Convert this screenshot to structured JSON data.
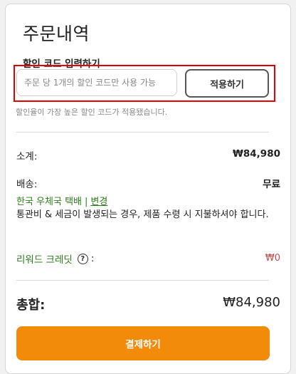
{
  "order": {
    "title": "주문내역",
    "promo": {
      "label": "할인 코드 입력하기",
      "placeholder": "주문 당 1개의 할인 코드만 사용 가능",
      "apply_label": "적용하기",
      "note": "할인율이 가장 높은 할인 코드가 적용됐습니다."
    },
    "subtotal": {
      "label": "소계:",
      "value": "₩84,980"
    },
    "shipping": {
      "label": "배송:",
      "value": "무료",
      "method": "한국 우체국 택배",
      "separator": "|",
      "change_label": "변경",
      "note": "통관비 & 세금이 발생되는 경우, 제품 수령 시 지불하셔야 합니다."
    },
    "reward": {
      "label": "리워드 크레딧",
      "help_icon": "?",
      "colon": ":",
      "value": "₩0"
    },
    "total": {
      "label": "총합:",
      "value": "₩84,980"
    },
    "checkout_label": "결제하기"
  },
  "colors": {
    "accent": "#f28a0a",
    "highlight_border": "#e30000",
    "green_text": "#2e7d1e",
    "reward_value": "#c0504d"
  },
  "icons": {
    "help": "question-circle-icon"
  }
}
